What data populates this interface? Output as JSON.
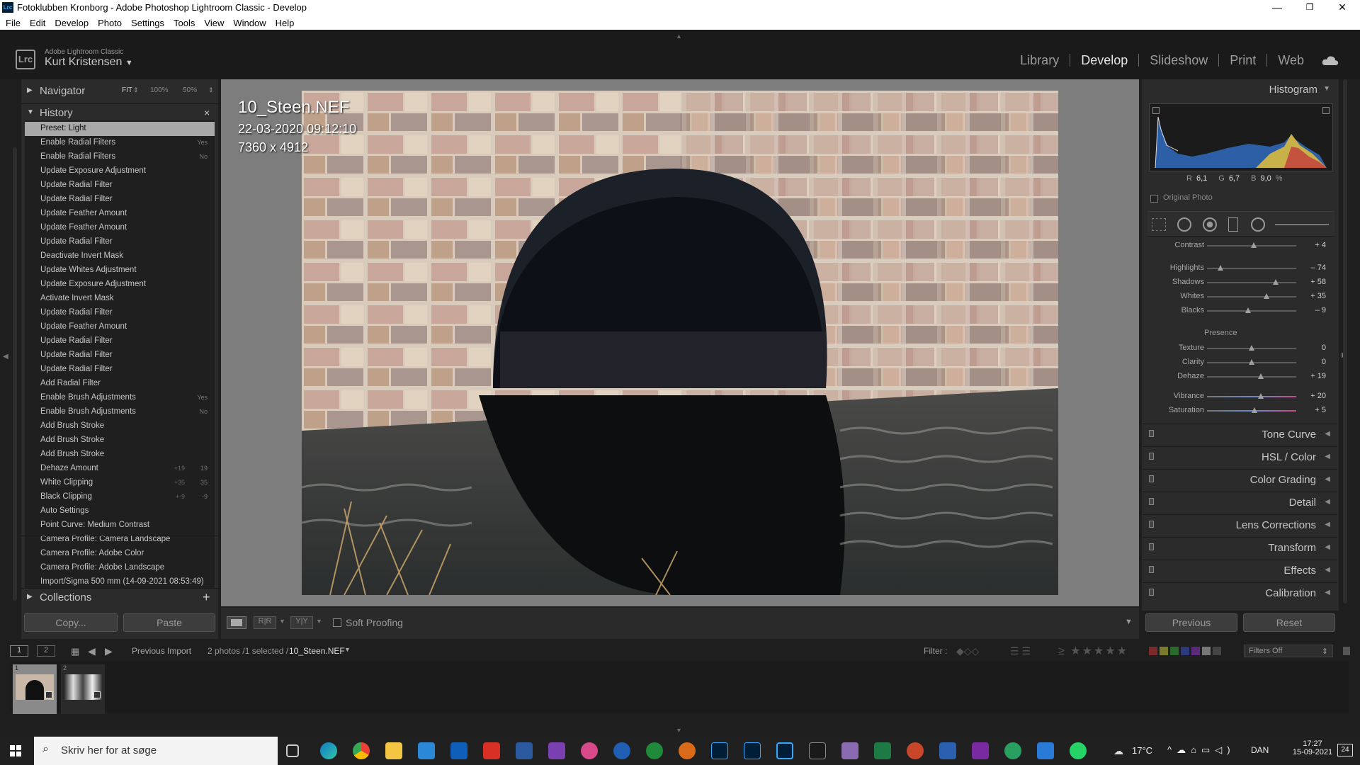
{
  "window": {
    "title": "Fotoklubben Kronborg - Adobe Photoshop Lightroom Classic - Develop",
    "minimize": "—",
    "maximize": "❐",
    "close": "✕"
  },
  "menu": [
    "File",
    "Edit",
    "Develop",
    "Photo",
    "Settings",
    "Tools",
    "View",
    "Window",
    "Help"
  ],
  "header": {
    "logo": "Lrc",
    "app_name": "Adobe Lightroom Classic",
    "user": "Kurt Kristensen"
  },
  "modules": [
    {
      "label": "Library",
      "active": false
    },
    {
      "label": "Develop",
      "active": true
    },
    {
      "label": "Slideshow",
      "active": false
    },
    {
      "label": "Print",
      "active": false
    },
    {
      "label": "Web",
      "active": false
    }
  ],
  "navigator": {
    "label": "Navigator",
    "fit": "FIT",
    "z100": "100%",
    "z50": "50%"
  },
  "history": {
    "label": "History",
    "items": [
      {
        "label": "Preset: Light",
        "v1": "",
        "v2": "",
        "selected": true
      },
      {
        "label": "Enable Radial Filters",
        "v1": "",
        "v2": "Yes"
      },
      {
        "label": "Enable Radial Filters",
        "v1": "",
        "v2": "No"
      },
      {
        "label": "Update Exposure Adjustment",
        "v1": "",
        "v2": ""
      },
      {
        "label": "Update Radial Filter",
        "v1": "",
        "v2": ""
      },
      {
        "label": "Update Radial Filter",
        "v1": "",
        "v2": ""
      },
      {
        "label": "Update Feather Amount",
        "v1": "",
        "v2": ""
      },
      {
        "label": "Update Feather Amount",
        "v1": "",
        "v2": ""
      },
      {
        "label": "Update Radial Filter",
        "v1": "",
        "v2": ""
      },
      {
        "label": "Deactivate Invert Mask",
        "v1": "",
        "v2": ""
      },
      {
        "label": "Update Whites Adjustment",
        "v1": "",
        "v2": ""
      },
      {
        "label": "Update Exposure Adjustment",
        "v1": "",
        "v2": ""
      },
      {
        "label": "Activate Invert Mask",
        "v1": "",
        "v2": ""
      },
      {
        "label": "Update Radial Filter",
        "v1": "",
        "v2": ""
      },
      {
        "label": "Update Feather Amount",
        "v1": "",
        "v2": ""
      },
      {
        "label": "Update Radial Filter",
        "v1": "",
        "v2": ""
      },
      {
        "label": "Update Radial Filter",
        "v1": "",
        "v2": ""
      },
      {
        "label": "Update Radial Filter",
        "v1": "",
        "v2": ""
      },
      {
        "label": "Add Radial Filter",
        "v1": "",
        "v2": ""
      },
      {
        "label": "Enable Brush Adjustments",
        "v1": "",
        "v2": "Yes"
      },
      {
        "label": "Enable Brush Adjustments",
        "v1": "",
        "v2": "No"
      },
      {
        "label": "Add Brush Stroke",
        "v1": "",
        "v2": ""
      },
      {
        "label": "Add Brush Stroke",
        "v1": "",
        "v2": ""
      },
      {
        "label": "Add Brush Stroke",
        "v1": "",
        "v2": ""
      },
      {
        "label": "Dehaze Amount",
        "v1": "+19",
        "v2": "19"
      },
      {
        "label": "White Clipping",
        "v1": "+35",
        "v2": "35"
      },
      {
        "label": "Black Clipping",
        "v1": "+-9",
        "v2": "-9"
      },
      {
        "label": "Auto Settings",
        "v1": "",
        "v2": ""
      },
      {
        "label": "Point Curve: Medium Contrast",
        "v1": "",
        "v2": ""
      },
      {
        "label": "Camera Profile: Camera Landscape",
        "v1": "",
        "v2": ""
      },
      {
        "label": "Camera Profile: Adobe Color",
        "v1": "",
        "v2": ""
      },
      {
        "label": "Camera Profile: Adobe Landscape",
        "v1": "",
        "v2": ""
      },
      {
        "label": "Import/Sigma 500 mm (14-09-2021 08:53:49)",
        "v1": "",
        "v2": ""
      }
    ]
  },
  "collections": {
    "label": "Collections",
    "add": "+"
  },
  "left_buttons": {
    "copy": "Copy...",
    "paste": "Paste"
  },
  "photo_info": {
    "filename": "10_Steen.NEF",
    "date": "22-03-2020 09:12:10",
    "dimensions": "7360 x 4912"
  },
  "toolbar": {
    "soft_proofing": "Soft Proofing",
    "rr": "R|R",
    "yy": "Y|Y"
  },
  "histogram": {
    "label": "Histogram",
    "r_label": "R",
    "r": "6,1",
    "g_label": "G",
    "g": "6,7",
    "b_label": "B",
    "b": "9,0",
    "pct": "%",
    "original_photo": "Original Photo"
  },
  "basic": {
    "contrast": {
      "label": "Contrast",
      "value": "+ 4",
      "level": 0.52
    },
    "highlights": {
      "label": "Highlights",
      "value": "– 74",
      "level": 0.15
    },
    "shadows": {
      "label": "Shadows",
      "value": "+ 58",
      "level": 0.77
    },
    "whites": {
      "label": "Whites",
      "value": "+ 35",
      "level": 0.67
    },
    "blacks": {
      "label": "Blacks",
      "value": "– 9",
      "level": 0.46
    },
    "presence": "Presence",
    "texture": {
      "label": "Texture",
      "value": "0",
      "level": 0.5
    },
    "clarity": {
      "label": "Clarity",
      "value": "0",
      "level": 0.5
    },
    "dehaze": {
      "label": "Dehaze",
      "value": "+ 19",
      "level": 0.6
    },
    "vibrance": {
      "label": "Vibrance",
      "value": "+ 20",
      "level": 0.6
    },
    "saturation": {
      "label": "Saturation",
      "value": "+ 5",
      "level": 0.53
    }
  },
  "right_panels": [
    {
      "label": "Tone Curve"
    },
    {
      "label": "HSL / Color"
    },
    {
      "label": "Color Grading"
    },
    {
      "label": "Detail"
    },
    {
      "label": "Lens Corrections"
    },
    {
      "label": "Transform"
    },
    {
      "label": "Effects"
    },
    {
      "label": "Calibration"
    }
  ],
  "right_buttons": {
    "previous": "Previous",
    "reset": "Reset"
  },
  "filmbar": {
    "screen1": "1",
    "screen2": "2",
    "source": "Previous Import",
    "count": "2 photos /1 selected /",
    "current": "10_Steen.NEF",
    "filter": "Filter :",
    "filters_off": "Filters Off"
  },
  "filmstrip": [
    {
      "index": "1"
    },
    {
      "index": "2"
    }
  ],
  "taskbar": {
    "search_placeholder": "Skriv her for at søge",
    "weather": "17°C",
    "lang": "DAN",
    "time": "17:27",
    "date": "15-09-2021",
    "notif": "24"
  },
  "colors": {
    "bg": "#1e1e1e",
    "panel": "#2b2b2b",
    "canvas": "#7d7d7d",
    "accent": "#e6e6e6"
  }
}
